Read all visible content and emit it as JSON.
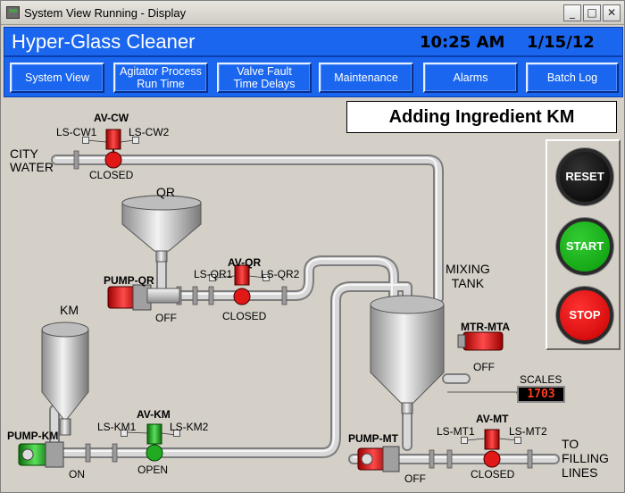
{
  "window": {
    "title": "System View Running - Display",
    "controls": [
      "_",
      "□",
      "✕"
    ]
  },
  "header": {
    "app_title": "Hyper-Glass Cleaner",
    "time": "10:25 AM",
    "date": "1/15/12"
  },
  "nav": {
    "system_view": "System View",
    "agitator": "Agitator Process\nRun Time",
    "valve_fault": "Valve Fault\nTime Delays",
    "maintenance": "Maintenance",
    "alarms": "Alarms",
    "batch_log": "Batch Log"
  },
  "status_message": "Adding Ingredient KM",
  "controls": {
    "reset": "RESET",
    "start": "START",
    "stop": "STOP"
  },
  "plant": {
    "city_water": "CITY\nWATER",
    "av_cw": {
      "name": "AV-CW",
      "ls1": "LS-CW1",
      "ls2": "LS-CW2",
      "state": "CLOSED"
    },
    "qr_hopper": "QR",
    "pump_qr": {
      "name": "PUMP-QR",
      "state": "OFF"
    },
    "av_qr": {
      "name": "AV-QR",
      "ls1": "LS-QR1",
      "ls2": "LS-QR2",
      "state": "CLOSED"
    },
    "km_hopper": "KM",
    "pump_km": {
      "name": "PUMP-KM",
      "state": "ON"
    },
    "av_km": {
      "name": "AV-KM",
      "ls1": "LS-KM1",
      "ls2": "LS-KM2",
      "state": "OPEN"
    },
    "mixing_tank": "MIXING\nTANK",
    "mtr_mta": {
      "name": "MTR-MTA",
      "state": "OFF"
    },
    "scales": {
      "label": "SCALES",
      "value": "1703"
    },
    "pump_mt": {
      "name": "PUMP-MT",
      "state": "OFF"
    },
    "av_mt": {
      "name": "AV-MT",
      "ls1": "LS-MT1",
      "ls2": "LS-MT2",
      "state": "CLOSED"
    },
    "to_filling": "TO\nFILLING\nLINES"
  },
  "colors": {
    "header_blue": "#1a66ee",
    "valve_closed": "#e01818",
    "valve_open": "#22aa22",
    "pipe": "#c9c9c9"
  }
}
